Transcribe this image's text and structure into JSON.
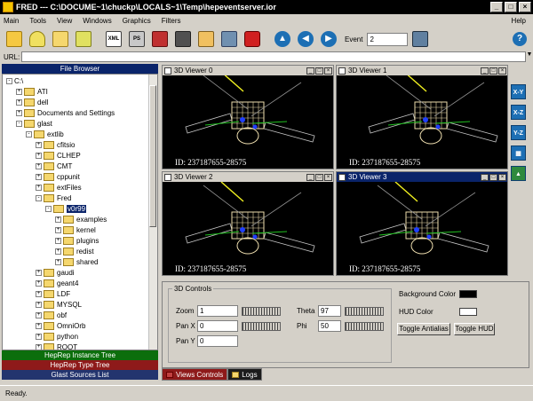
{
  "window": {
    "title": "FRED --- C:\\DOCUME~1\\chuckp\\LOCALS~1\\Temp\\hepeventserver.ior"
  },
  "menu": [
    "Main",
    "Tools",
    "View",
    "Windows",
    "Graphics",
    "Filters"
  ],
  "menu_help": "Help",
  "toolbar": {
    "event_label": "Event",
    "event_value": "2",
    "xml_label": "XML",
    "ps_label": "PS"
  },
  "url": {
    "label": "URL:",
    "value": ""
  },
  "file_browser": {
    "header": "File Browser",
    "tree": [
      {
        "label": "C:\\",
        "indent": 0,
        "exp": "-",
        "folder": false
      },
      {
        "label": "ATI",
        "indent": 1,
        "exp": "+",
        "folder": true
      },
      {
        "label": "dell",
        "indent": 1,
        "exp": "+",
        "folder": true
      },
      {
        "label": "Documents and Settings",
        "indent": 1,
        "exp": "+",
        "folder": true
      },
      {
        "label": "glast",
        "indent": 1,
        "exp": "-",
        "folder": true
      },
      {
        "label": "extlib",
        "indent": 2,
        "exp": "-",
        "folder": true
      },
      {
        "label": "cfitsio",
        "indent": 3,
        "exp": "+",
        "folder": true
      },
      {
        "label": "CLHEP",
        "indent": 3,
        "exp": "+",
        "folder": true
      },
      {
        "label": "CMT",
        "indent": 3,
        "exp": "+",
        "folder": true
      },
      {
        "label": "cppunit",
        "indent": 3,
        "exp": "+",
        "folder": true
      },
      {
        "label": "extFiles",
        "indent": 3,
        "exp": "+",
        "folder": true
      },
      {
        "label": "Fred",
        "indent": 3,
        "exp": "-",
        "folder": true
      },
      {
        "label": "v0r99",
        "indent": 4,
        "exp": "-",
        "folder": true,
        "selected": true
      },
      {
        "label": "examples",
        "indent": 5,
        "exp": "+",
        "folder": true
      },
      {
        "label": "kernel",
        "indent": 5,
        "exp": "+",
        "folder": true
      },
      {
        "label": "plugins",
        "indent": 5,
        "exp": "+",
        "folder": true
      },
      {
        "label": "redist",
        "indent": 5,
        "exp": "+",
        "folder": true
      },
      {
        "label": "shared",
        "indent": 5,
        "exp": "+",
        "folder": true
      },
      {
        "label": "gaudi",
        "indent": 3,
        "exp": "+",
        "folder": true
      },
      {
        "label": "geant4",
        "indent": 3,
        "exp": "+",
        "folder": true
      },
      {
        "label": "LDF",
        "indent": 3,
        "exp": "+",
        "folder": true
      },
      {
        "label": "MYSQL",
        "indent": 3,
        "exp": "+",
        "folder": true
      },
      {
        "label": "obf",
        "indent": 3,
        "exp": "+",
        "folder": true
      },
      {
        "label": "OmniOrb",
        "indent": 3,
        "exp": "+",
        "folder": true
      },
      {
        "label": "python",
        "indent": 3,
        "exp": "+",
        "folder": true
      },
      {
        "label": "ROOT",
        "indent": 3,
        "exp": "+",
        "folder": true
      }
    ],
    "bottom_tabs": [
      "HepRep Instance Tree",
      "HepRep Type Tree",
      "Glast Sources List"
    ]
  },
  "viewers": [
    {
      "title": "3D Viewer 0",
      "id": "ID: 237187655-28575",
      "active": false
    },
    {
      "title": "3D Viewer 1",
      "id": "ID: 237187655-28575",
      "active": false
    },
    {
      "title": "3D Viewer 2",
      "id": "ID: 237187655-28575",
      "active": false
    },
    {
      "title": "3D Viewer 3",
      "id": "ID: 237187655-28575",
      "active": true
    }
  ],
  "view_tools": [
    "X-Y",
    "X-Z",
    "Y-Z",
    "",
    ""
  ],
  "controls": {
    "group_label": "3D Controls",
    "zoom_label": "Zoom",
    "zoom_value": "1",
    "panx_label": "Pan X",
    "panx_value": "0",
    "pany_label": "Pan Y",
    "pany_value": "0",
    "theta_label": "Theta",
    "theta_value": "97",
    "phi_label": "Phi",
    "phi_value": "50",
    "bg_color_label": "Background Color",
    "bg_color": "#000000",
    "hud_color_label": "HUD Color",
    "hud_color": "#ffffff",
    "toggle_antialias": "Toggle Antialias",
    "toggle_hud": "Toggle HUD"
  },
  "bottom_tabs": [
    "Views Controls",
    "Logs"
  ],
  "status": "Ready."
}
